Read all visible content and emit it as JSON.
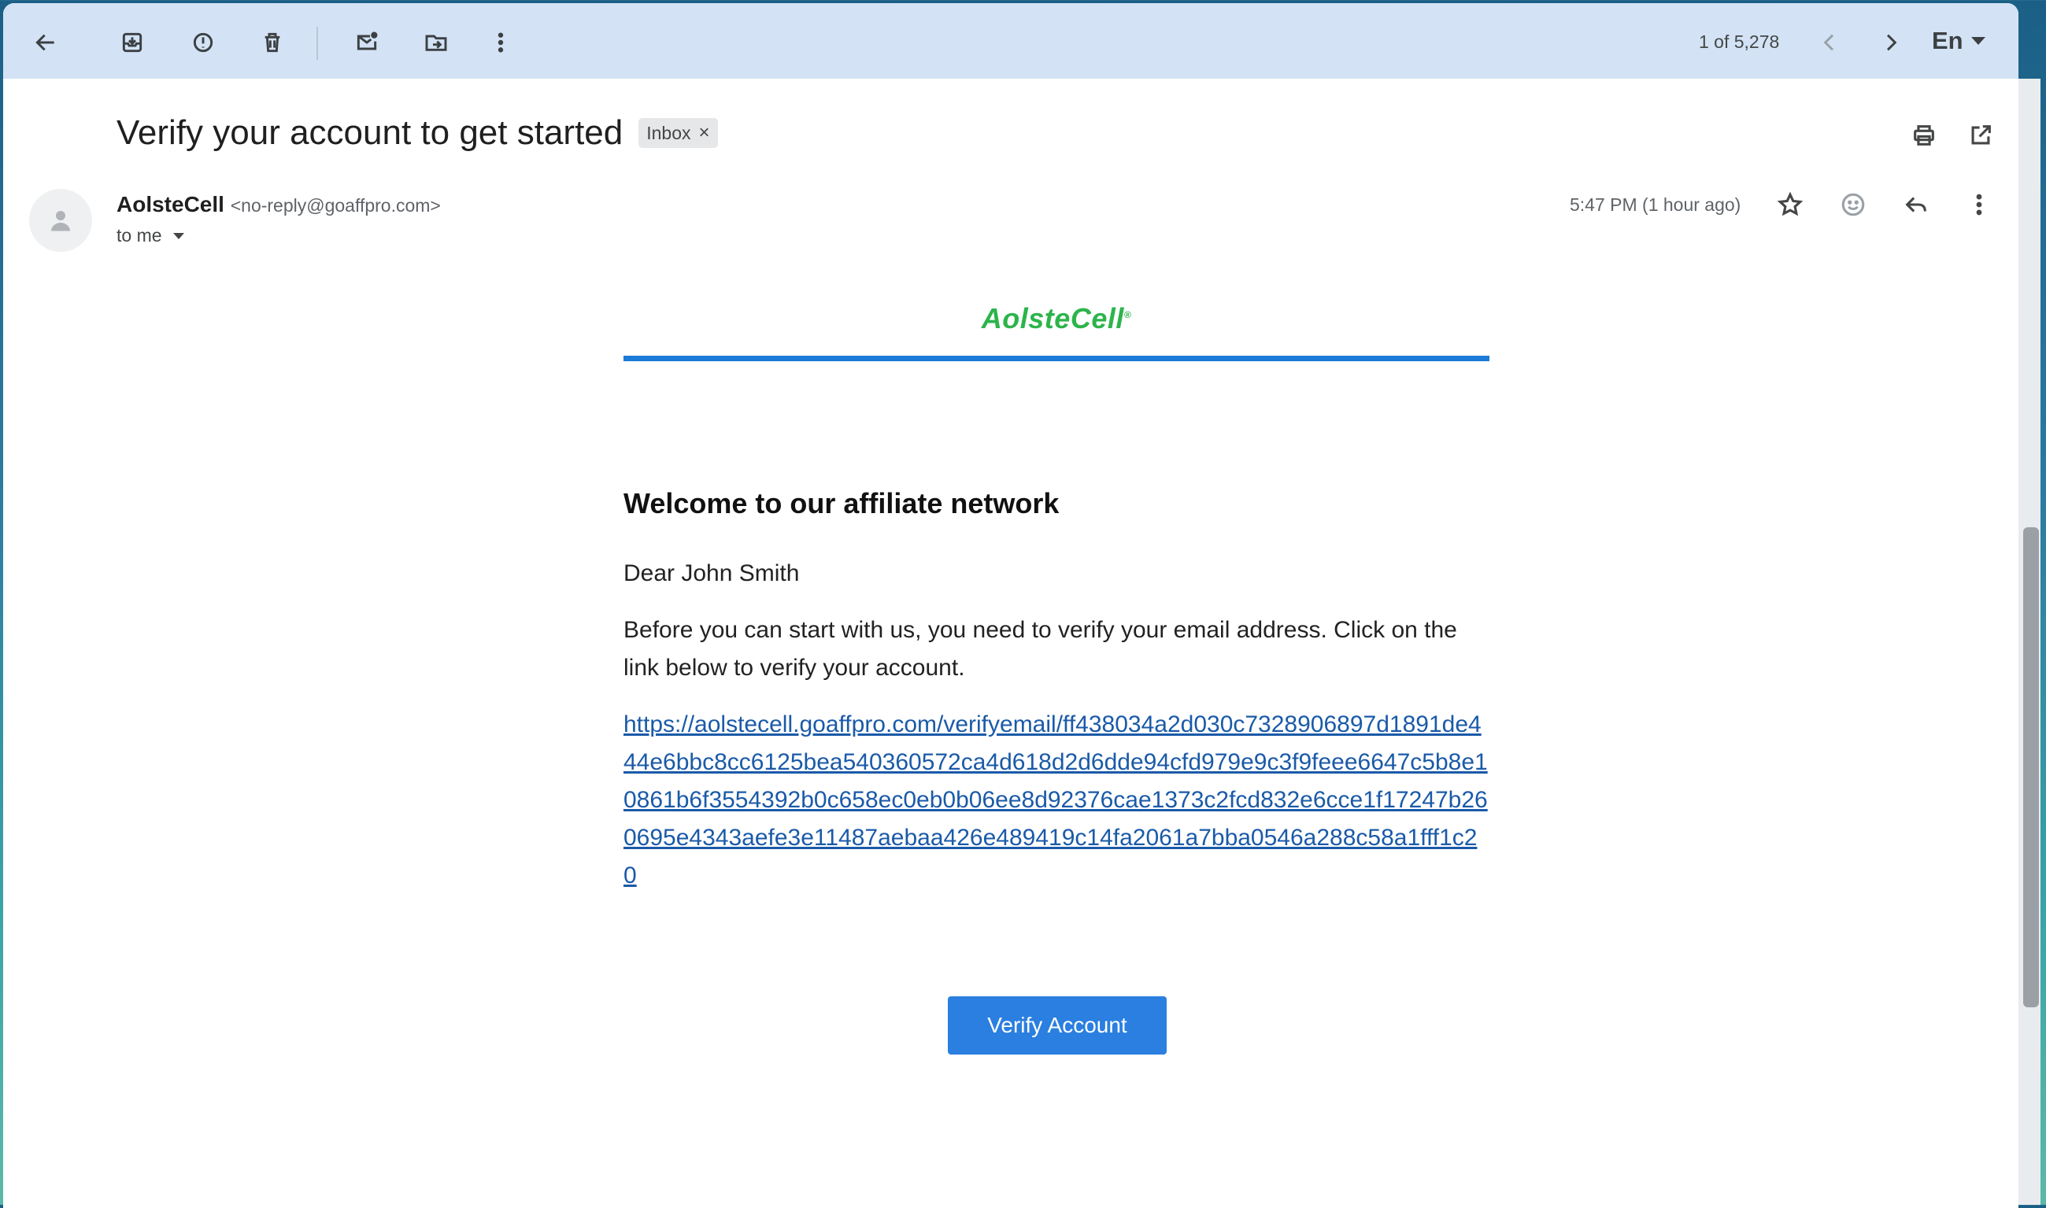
{
  "toolbar": {
    "count": "1 of 5,278",
    "language": "En"
  },
  "email": {
    "subject": "Verify your account to get started",
    "label_chip": "Inbox",
    "chip_close": "×",
    "sender_name": "AolsteCell",
    "sender_address": "<no-reply@goaffpro.com>",
    "recipient": "to me",
    "timestamp": "5:47 PM (1 hour ago)"
  },
  "body": {
    "brand": "AolsteCell",
    "brand_mark": "®",
    "heading": "Welcome to our affiliate network",
    "greeting": "Dear John Smith",
    "paragraph": "Before you can start with us, you need to verify your email address. Click on the link below to verify your account.",
    "link": "https://aolstecell.goaffpro.com/verifyemail/ff438034a2d030c7328906897d1891de444e6bbc8cc6125bea540360572ca4d618d2d6dde94cfd979e9c3f9feee6647c5b8e10861b6f3554392b0c658ec0eb0b06ee8d92376cae1373c2fcd832e6cce1f17247b260695e4343aefe3e11487aebaa426e489419c14fa2061a7bba0546a288c58a1fff1c20",
    "button": "Verify Account"
  },
  "icons": [
    "back-arrow-icon",
    "archive-icon",
    "report-spam-icon",
    "delete-icon",
    "mark-unread-icon",
    "move-to-icon",
    "more-vert-icon",
    "chevron-left-icon",
    "chevron-right-icon",
    "print-icon",
    "open-new-window-icon",
    "star-icon",
    "emoji-icon",
    "reply-icon"
  ],
  "colors": {
    "toolbar_bg": "#d3e3f5",
    "brand_green": "#2cb44b",
    "rule_blue": "#1c7ad8",
    "button_blue": "#2a7fe0",
    "link_blue": "#1a5aa8"
  }
}
